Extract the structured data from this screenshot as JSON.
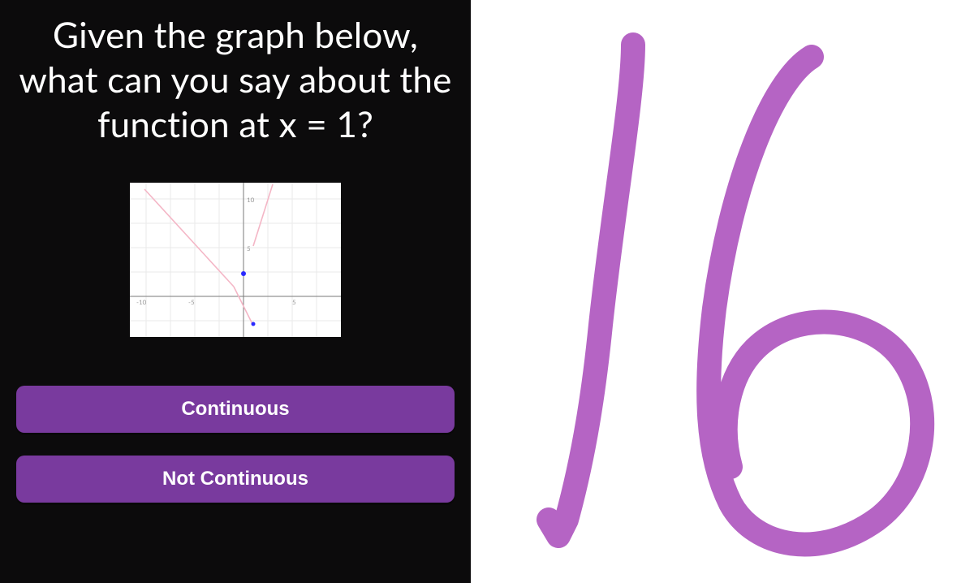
{
  "quiz": {
    "question": "Given the graph below, what can you say about the function at x = 1?",
    "answers": [
      {
        "label": "Continuous"
      },
      {
        "label": "Not Continuous"
      }
    ]
  },
  "graph": {
    "x_range": [
      -10,
      10
    ],
    "y_range": [
      -5,
      12
    ],
    "tick_labels": {
      "neg10": "-10",
      "neg5": "-5",
      "five": "5",
      "ten_y": "10",
      "five_y": "5"
    }
  },
  "handwriting": {
    "value": "16",
    "stroke_color": "#b564c4"
  },
  "colors": {
    "panel_bg": "#0c0b0c",
    "button_bg": "#793a9e",
    "graph_line": "#f4b6c6",
    "graph_point": "#2a2aff"
  }
}
